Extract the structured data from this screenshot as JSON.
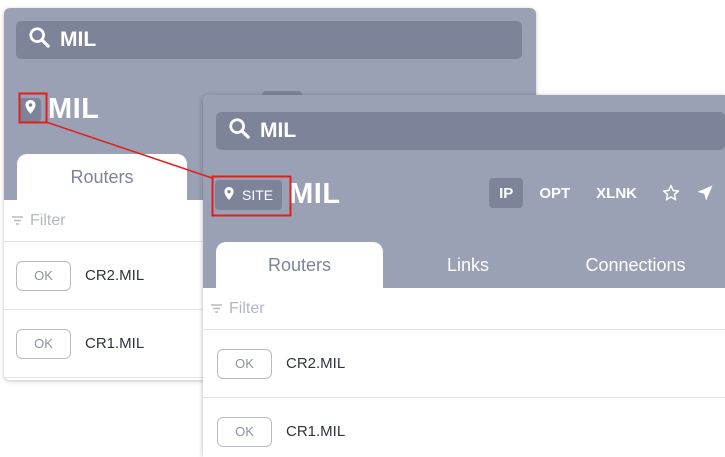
{
  "search_query": "MIL",
  "site": {
    "name": "MIL",
    "button_label": "SITE"
  },
  "modes": {
    "ip": "IP",
    "opt": "OPT",
    "xlnk": "XLNK"
  },
  "tabs": [
    "Routers",
    "Links",
    "Connections"
  ],
  "filter_placeholder": "Filter",
  "routers": [
    {
      "status": "OK",
      "name": "CR2.MIL"
    },
    {
      "status": "OK",
      "name": "CR1.MIL"
    }
  ],
  "colors": {
    "header": "#9aa1b5",
    "control": "#7d8499",
    "highlight": "#e0201b"
  }
}
